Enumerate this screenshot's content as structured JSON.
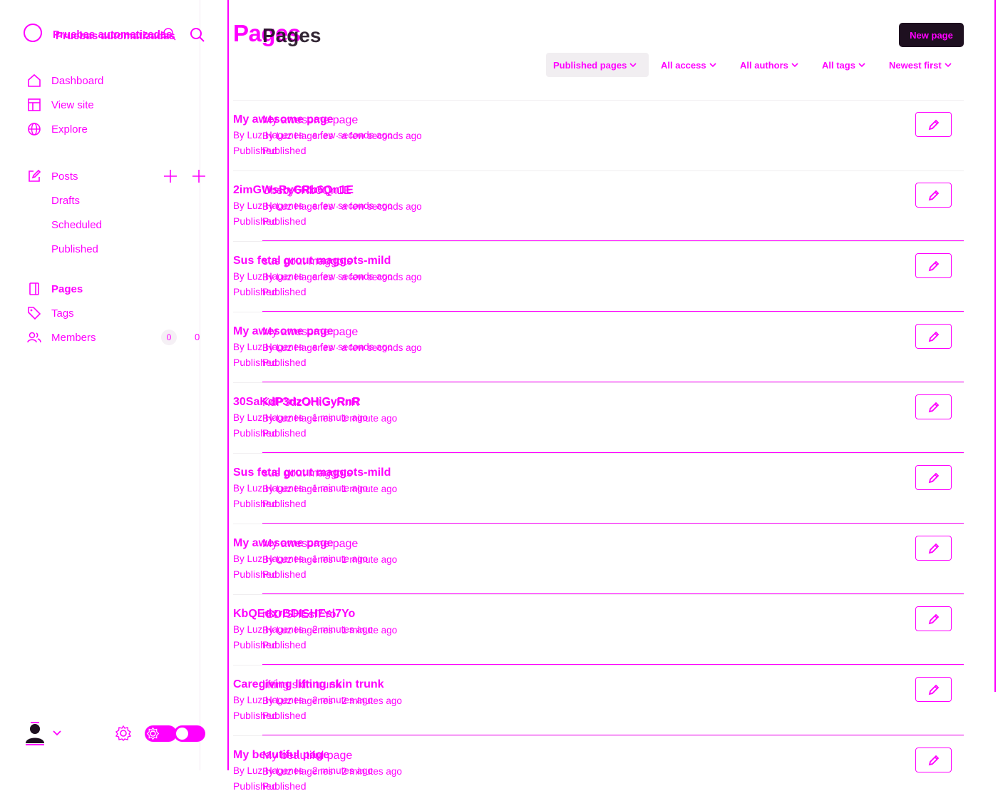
{
  "site": {
    "name": "Pruebas automatizadas"
  },
  "nav": {
    "dashboard": "Dashboard",
    "view_site": "View site",
    "explore": "Explore",
    "posts": "Posts",
    "drafts": "Drafts",
    "scheduled": "Scheduled",
    "published": "Published",
    "pages": "Pages",
    "tags": "Tags",
    "members": "Members",
    "members_count": "0"
  },
  "header": {
    "title": "Pages",
    "new_button": "New page"
  },
  "filters": {
    "type": "Published pages",
    "access": "All access",
    "authors": "All authors",
    "tags": "All tags",
    "order": "Newest first"
  },
  "pages": [
    {
      "title": "My awesome page",
      "meta": "By Luz Hagenes · a few seconds ago",
      "status": "Published"
    },
    {
      "title": "2imGWsRyGRb6Qn1E",
      "meta": "By Luz Hagenes · a few seconds ago",
      "status": "Published"
    },
    {
      "title": "Sus fetal grout maggots-mild",
      "meta": "By Luz Hagenes · a few seconds ago",
      "status": "Published"
    },
    {
      "title": "My awesome page",
      "meta": "By Luz Hagenes · a few seconds ago",
      "status": "Published"
    },
    {
      "title": "30SaKdP3dzOHiGyRnR",
      "meta": "By Luz Hagenes · 1 minute ago",
      "status": "Published"
    },
    {
      "title": "Sus fetal grout maggots-mild",
      "meta": "By Luz Hagenes · 1 minute ago",
      "status": "Published"
    },
    {
      "title": "My awesome page",
      "meta": "By Luz Hagenes · 1 minute ago",
      "status": "Published"
    },
    {
      "title": "KbQEdxrBDISHEsl7Yo",
      "meta": "By Luz Hagenes · 2 minutes ago",
      "status": "Published"
    },
    {
      "title": "Caregiving lifting skin trunk",
      "meta": "By Luz Hagenes · 2 minutes ago",
      "status": "Published"
    },
    {
      "title": "My beautiful page",
      "meta": "By Luz Hagenes · 2 minutes ago",
      "status": "Published"
    }
  ],
  "ghost": {
    "titles": [
      "My awesome page",
      "Ubsby6Rb0Qn1E",
      "sus gout maggots",
      "My awesome page",
      "KdP3dzOHiGyRnR",
      "sus gout maggots",
      "My awesome page",
      "rBDISHEsl7Yo",
      "lifting skin trunk",
      "My beautiful page"
    ],
    "metas": [
      "By Luz Hagenes · a few seconds ago",
      "By Luz Hagenes · a few seconds ago",
      "By Luz Hagenes · a few seconds ago",
      "By Luz Hagenes · a few seconds ago",
      "By Luz Hagenes · 1 minute ago",
      "By Luz Hagenes · 1 minute ago",
      "By Luz Hagenes · 1 minute ago",
      "By Luz Hagenes · 1 minute ago",
      "By Luz Hagenes · 2 minutes ago",
      "By Luz Hagenes · 2 minutes ago"
    ],
    "status": "Published",
    "page_title": "Pages",
    "site_name": "Pruebas automatizadas",
    "members_count": "0"
  },
  "colors": {
    "accent": "#ff00ff",
    "button_bg": "#1e1020"
  }
}
